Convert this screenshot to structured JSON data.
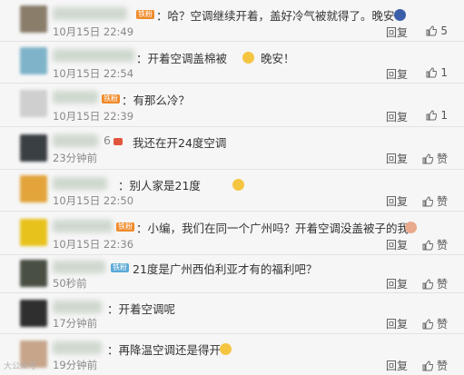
{
  "comments": [
    {
      "text": "：哈？空调继续开着，盖好冷气被就得了。晚安",
      "time": "10月15日 22:49",
      "reply": "回复",
      "likes": "5",
      "badge": "铁粉",
      "emoji": "moon-emoji"
    },
    {
      "text": "：开着空调盖棉被",
      "text2": "晚安！",
      "time": "10月15日 22:54",
      "reply": "回复",
      "likes": "1",
      "badge": "",
      "emoji": "laugh-emoji"
    },
    {
      "text": "：有那么冷？",
      "time": "10月15日 22:39",
      "reply": "回复",
      "likes": "1",
      "badge": "铁粉"
    },
    {
      "text": "我还在开24度空调",
      "prefix": "6",
      "time": "23分钟前",
      "reply": "回复",
      "likes": "赞",
      "badge": ""
    },
    {
      "text": "：别人家是21度",
      "time": "10月15日 22:50",
      "reply": "回复",
      "likes": "赞",
      "badge": "",
      "emoji": "laugh-emoji"
    },
    {
      "text": "：小编，我们在同一个广州吗？开着空调没盖被子的我",
      "time": "10月15日 22:36",
      "reply": "回复",
      "likes": "赞",
      "badge": "铁粉",
      "emoji": "face-emoji"
    },
    {
      "text": "21度是广州西伯利亚才有的福利吧？",
      "time": "50秒前",
      "reply": "回复",
      "likes": "赞",
      "badge": "铁粉"
    },
    {
      "text": "：开着空调呢",
      "time": "17分钟前",
      "reply": "回复",
      "likes": "赞",
      "badge": ""
    },
    {
      "text": "：再降温空调还是得开",
      "time": "19分钟前",
      "reply": "回复",
      "likes": "赞",
      "badge": "",
      "emoji": "smile-emoji"
    }
  ],
  "watermark": "大公众号"
}
